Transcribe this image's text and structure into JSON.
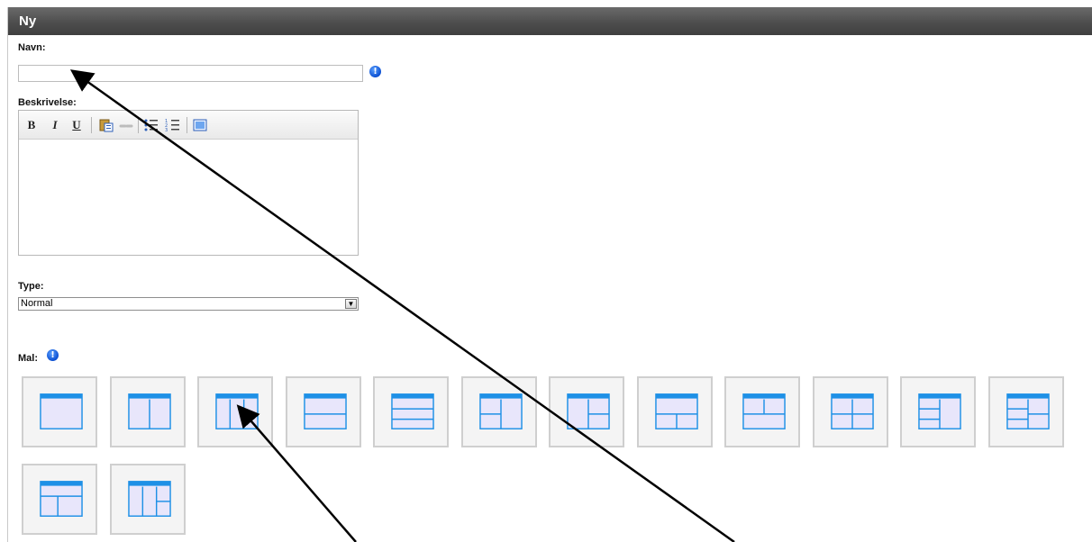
{
  "header": {
    "title": "Ny"
  },
  "form": {
    "name_label": "Navn:",
    "name_value": "",
    "name_info_icon": "info-icon",
    "description_label": "Beskrivelse:",
    "type_label": "Type:",
    "type_selected": "Normal",
    "template_label": "Mal:",
    "template_info_icon": "info-icon"
  },
  "editor_toolbar": {
    "bold": "B",
    "italic": "I",
    "underline": "U",
    "icons": [
      "paste-icon",
      "link-icon",
      "bullet-list-icon",
      "numbered-list-icon",
      "source-icon"
    ]
  },
  "templates": [
    {
      "layout": "single"
    },
    {
      "layout": "two-columns"
    },
    {
      "layout": "three-columns"
    },
    {
      "layout": "two-rows"
    },
    {
      "layout": "three-rows"
    },
    {
      "layout": "left-wide-split"
    },
    {
      "layout": "right-split"
    },
    {
      "layout": "top-bottom-split"
    },
    {
      "layout": "top-split-bottom"
    },
    {
      "layout": "four-grid"
    },
    {
      "layout": "left-stack-right"
    },
    {
      "layout": "mixed-grid"
    },
    {
      "layout": "sidebar-left"
    },
    {
      "layout": "three-col-split"
    }
  ],
  "colors": {
    "header_bg": "#4e4e4e",
    "template_accent": "#1e90e6",
    "template_fill": "#e8e6fb",
    "info_icon": "#0b4fd1"
  }
}
